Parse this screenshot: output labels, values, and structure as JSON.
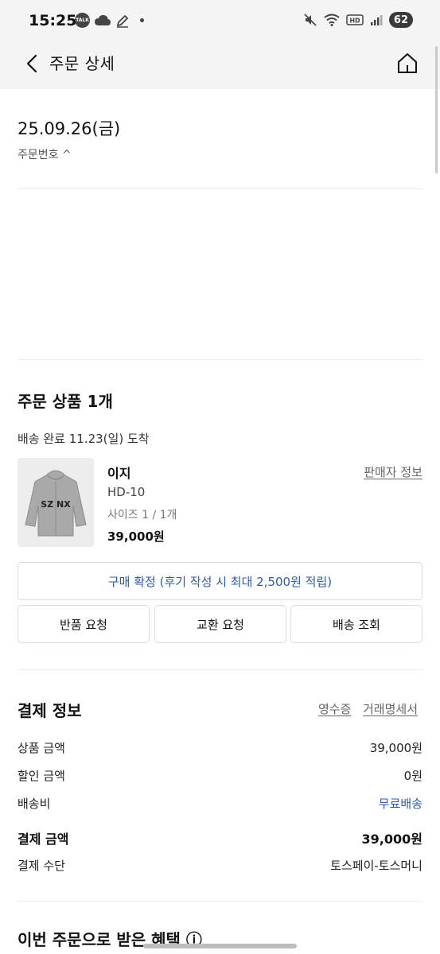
{
  "status_bar": {
    "time": "15:25",
    "notifications": [
      "talk-icon",
      "cloud-icon",
      "pencil-icon"
    ],
    "network": "HD",
    "battery": "62"
  },
  "header": {
    "title": "주문 상세"
  },
  "order": {
    "date": "25.09.26(금)",
    "number_label": "주문번호 ^"
  },
  "items_section": {
    "title": "주문 상품 1개",
    "delivery_status": "배송 완료 11.23(일) 도착",
    "product": {
      "image_text": "SZ NX",
      "name": "이지",
      "model": "HD-10",
      "option": "사이즈 1 / 1개",
      "price": "39,000원",
      "seller_link": "판매자 정보"
    },
    "confirm_button": "구매 확정 (후기 작성 시 최대 2,500원 적립)",
    "actions": [
      "반품 요청",
      "교환 요청",
      "배송 조회"
    ]
  },
  "payment": {
    "title": "결제 정보",
    "receipt_link": "영수증",
    "statement_link": "거래명세서",
    "rows": [
      {
        "label": "상품 금액",
        "value": "39,000원"
      },
      {
        "label": "할인 금액",
        "value": "0원"
      },
      {
        "label": "배송비",
        "value": "무료배송"
      },
      {
        "label": "결제 금액",
        "value": "39,000원"
      },
      {
        "label": "결제 수단",
        "value": "토스페이-토스머니"
      }
    ]
  },
  "benefit": {
    "title": "이번 주문으로 받은 혜택 ⓘ"
  },
  "colors": {
    "accent_blue": "#2f5aa8",
    "header_bg": "#f4f4f4",
    "border": "#dcdcdc"
  }
}
